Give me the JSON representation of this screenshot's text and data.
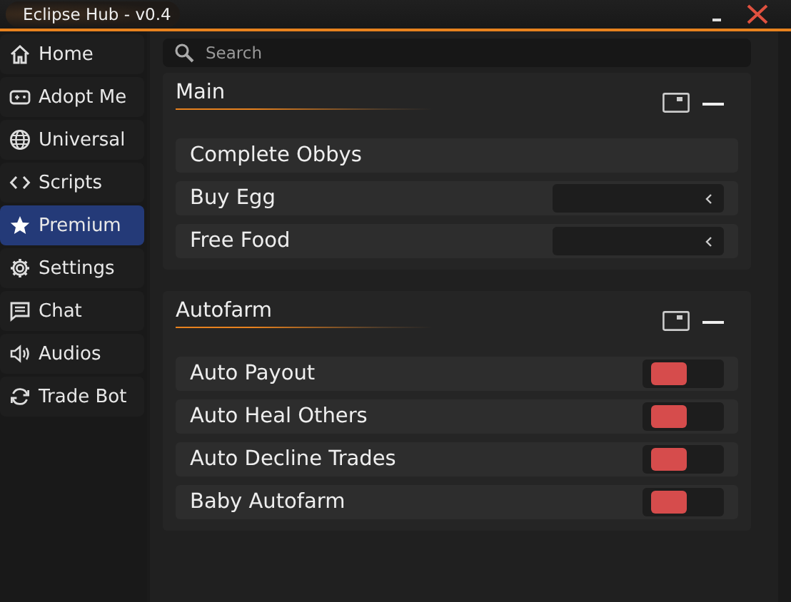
{
  "window": {
    "title": "Eclipse Hub - v0.4"
  },
  "sidebar": {
    "items": [
      {
        "label": "Home",
        "kind": "home",
        "selected": false
      },
      {
        "label": "Adopt Me",
        "kind": "gamepad",
        "selected": false
      },
      {
        "label": "Universal",
        "kind": "globe",
        "selected": false
      },
      {
        "label": "Scripts",
        "kind": "code",
        "selected": false
      },
      {
        "label": "Premium",
        "kind": "star",
        "selected": true
      },
      {
        "label": "Settings",
        "kind": "gear",
        "selected": false
      },
      {
        "label": "Chat",
        "kind": "chat",
        "selected": false
      },
      {
        "label": "Audios",
        "kind": "speaker",
        "selected": false
      },
      {
        "label": "Trade Bot",
        "kind": "refresh",
        "selected": false
      }
    ]
  },
  "search": {
    "placeholder": "Search"
  },
  "sections": [
    {
      "title": "Main",
      "items": [
        {
          "kind": "button",
          "label": "Complete Obbys"
        },
        {
          "kind": "dropdown",
          "label": "Buy Egg"
        },
        {
          "kind": "dropdown",
          "label": "Free Food"
        }
      ]
    },
    {
      "title": "Autofarm",
      "items": [
        {
          "kind": "toggle",
          "label": "Auto Payout",
          "on": false
        },
        {
          "kind": "toggle",
          "label": "Auto Heal Others",
          "on": false
        },
        {
          "kind": "toggle",
          "label": "Auto Decline Trades",
          "on": false
        },
        {
          "kind": "toggle",
          "label": "Baby Autofarm",
          "on": false
        }
      ]
    }
  ]
}
